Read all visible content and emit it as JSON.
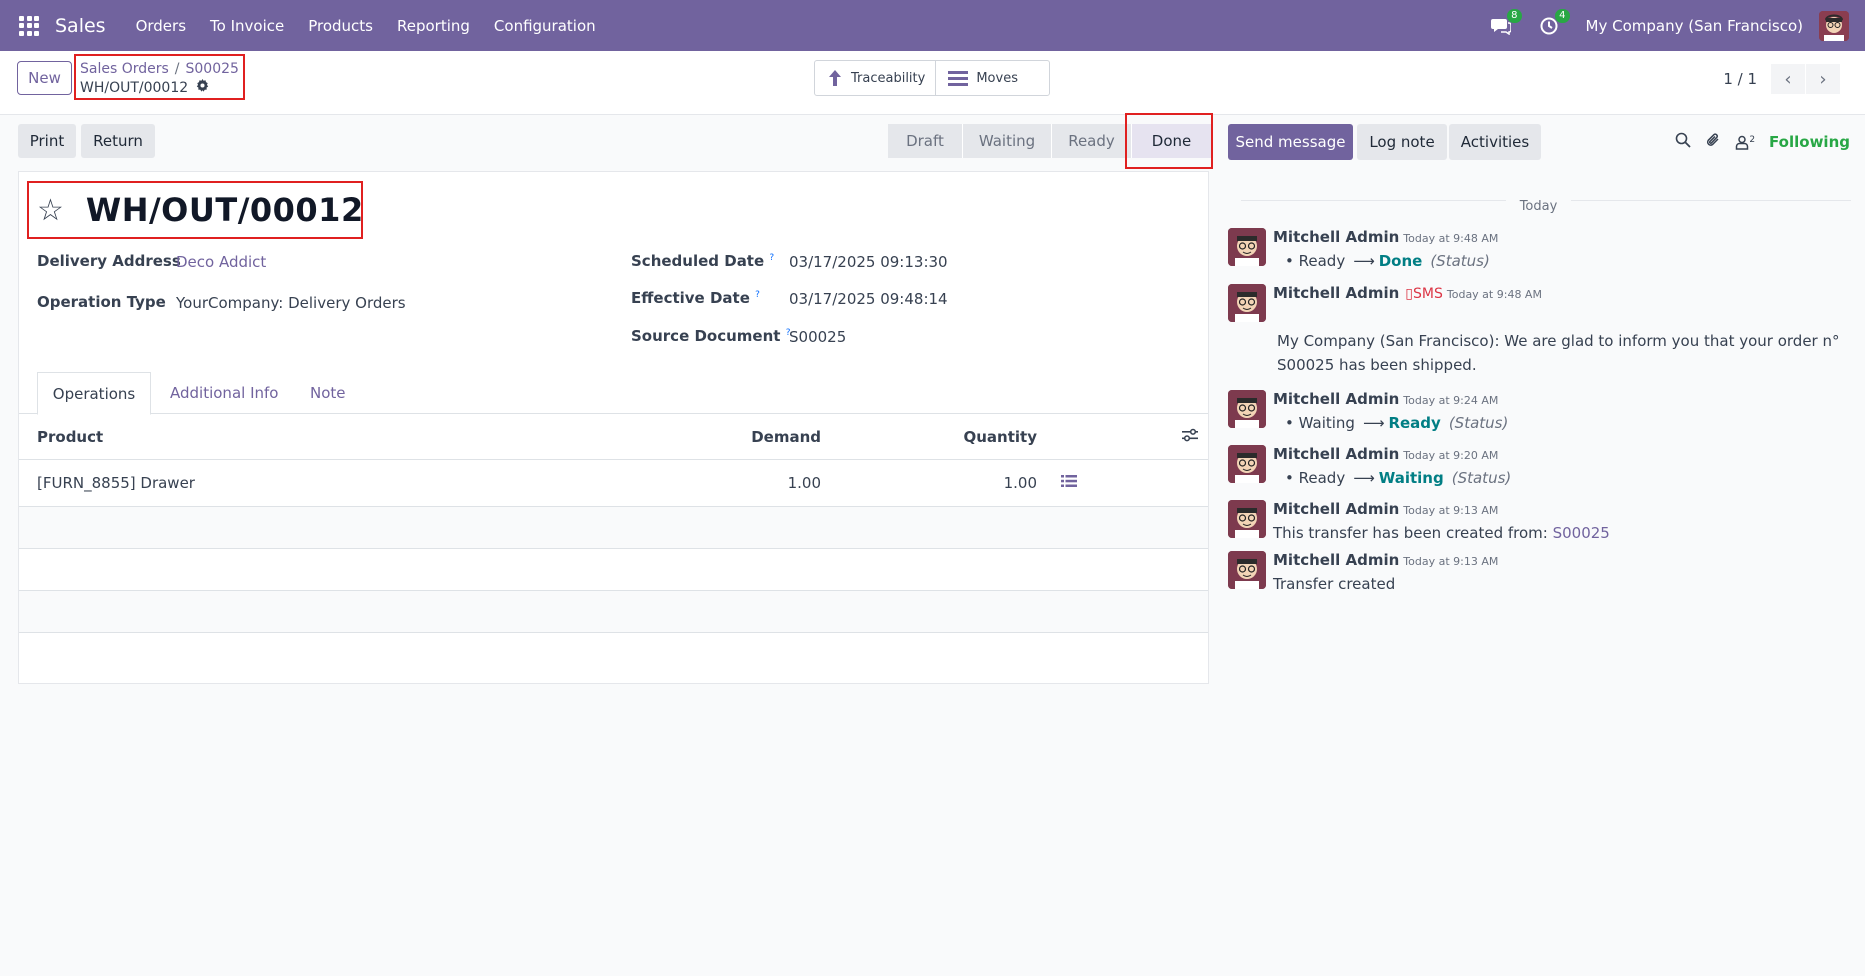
{
  "topnav": {
    "app_name": "Sales",
    "menu": [
      "Orders",
      "To Invoice",
      "Products",
      "Reporting",
      "Configuration"
    ],
    "messages_count": "8",
    "activities_count": "4",
    "company": "My Company (San Francisco)"
  },
  "control": {
    "new_label": "New",
    "breadcrumb": [
      "Sales Orders",
      "S00025"
    ],
    "current": "WH/OUT/00012",
    "smart_buttons": [
      "Traceability",
      "Moves"
    ],
    "pager": "1 / 1"
  },
  "statusbar": {
    "print_label": "Print",
    "return_label": "Return",
    "stages": [
      "Draft",
      "Waiting",
      "Ready",
      "Done"
    ],
    "active_stage": "Done"
  },
  "form": {
    "title": "WH/OUT/00012",
    "fields": {
      "delivery_address_label": "Delivery Address",
      "delivery_address": "Deco Addict",
      "operation_type_label": "Operation Type",
      "operation_type": "YourCompany: Delivery Orders",
      "scheduled_date_label": "Scheduled Date",
      "scheduled_date": "03/17/2025 09:13:30",
      "effective_date_label": "Effective Date",
      "effective_date": "03/17/2025 09:48:14",
      "source_document_label": "Source Document",
      "source_document": "S00025",
      "help_mark": "?"
    },
    "tabs": [
      "Operations",
      "Additional Info",
      "Note"
    ],
    "table": {
      "headers": [
        "Product",
        "Demand",
        "Quantity"
      ],
      "rows": [
        {
          "product": "[FURN_8855] Drawer",
          "demand": "1.00",
          "quantity": "1.00"
        }
      ]
    }
  },
  "chatter": {
    "send_message": "Send message",
    "log_note": "Log note",
    "activities": "Activities",
    "followers_count": "2",
    "following": "Following",
    "date_separator": "Today",
    "messages": [
      {
        "author": "Mitchell Admin",
        "time": "Today at 9:48 AM",
        "old": "Ready",
        "new": "Done",
        "field": "(Status)"
      },
      {
        "author": "Mitchell Admin",
        "sms": "SMS",
        "time": "Today at 9:48 AM",
        "line1": "My Company (San Francisco): We are glad to inform you that your order n°",
        "line2": "S00025 has been shipped."
      },
      {
        "author": "Mitchell Admin",
        "time": "Today at 9:24 AM",
        "old": "Waiting",
        "new": "Ready",
        "field": "(Status)"
      },
      {
        "author": "Mitchell Admin",
        "time": "Today at 9:20 AM",
        "old": "Ready",
        "new": "Waiting",
        "field": "(Status)"
      },
      {
        "author": "Mitchell Admin",
        "time": "Today at 9:13 AM",
        "text": "This transfer has been created from:",
        "link": "S00025"
      },
      {
        "author": "Mitchell Admin",
        "time": "Today at 9:13 AM",
        "text": "Transfer created"
      }
    ]
  }
}
